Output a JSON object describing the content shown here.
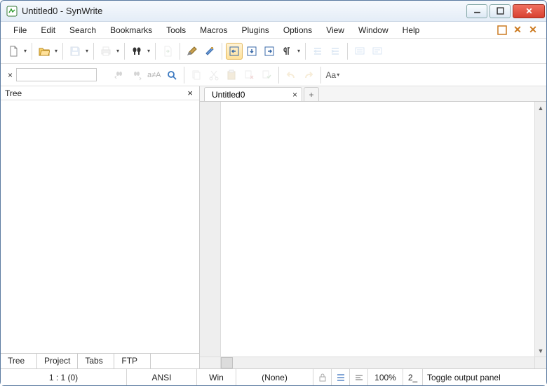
{
  "title": "Untitled0 - SynWrite",
  "menus": [
    "File",
    "Edit",
    "Search",
    "Bookmarks",
    "Tools",
    "Macros",
    "Plugins",
    "Options",
    "View",
    "Window",
    "Help"
  ],
  "left_panel": {
    "title": "Tree",
    "tabs": [
      "Tree",
      "Project",
      "Tabs",
      "FTP"
    ]
  },
  "editor_tabs": [
    {
      "label": "Untitled0"
    }
  ],
  "status": {
    "pos": "1 : 1 (0)",
    "encoding": "ANSI",
    "lineend": "Win",
    "syntax": "(None)",
    "zoom": "100%",
    "mode": "2_",
    "hint": "Toggle output panel"
  },
  "toolbar2": {
    "replace_label": "a≠A",
    "font_label": "Aa"
  }
}
